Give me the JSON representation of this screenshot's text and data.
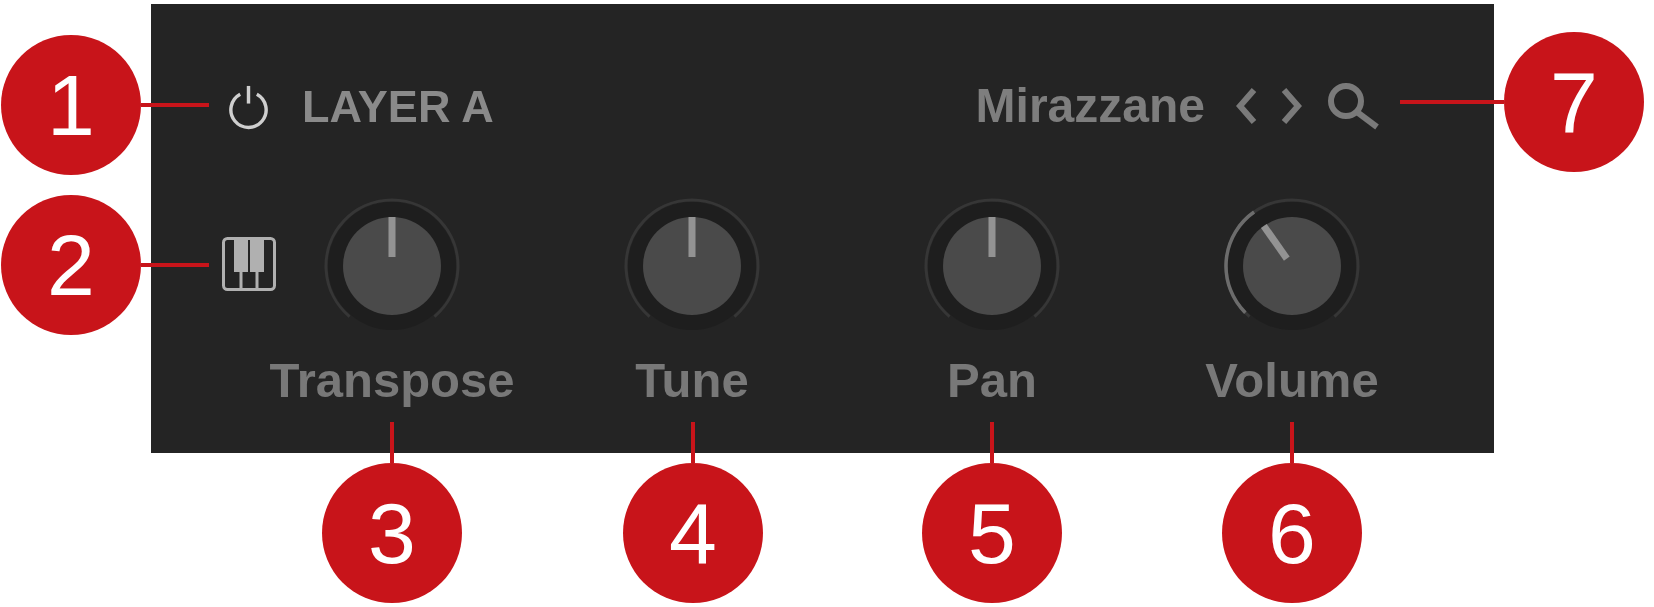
{
  "header": {
    "title": "LAYER A",
    "preset": "Mirazzane"
  },
  "knobs": [
    {
      "label": "Transpose",
      "kind": "bipolar",
      "level": 0.5
    },
    {
      "label": "Tune",
      "kind": "bipolar",
      "level": 0.5
    },
    {
      "label": "Pan",
      "kind": "bipolar",
      "level": 0.5
    },
    {
      "label": "Volume",
      "kind": "unipolar",
      "level": 0.37
    }
  ],
  "callouts": [
    {
      "number": "1"
    },
    {
      "number": "2"
    },
    {
      "number": "3"
    },
    {
      "number": "4"
    },
    {
      "number": "5"
    },
    {
      "number": "6"
    },
    {
      "number": "7"
    }
  ]
}
